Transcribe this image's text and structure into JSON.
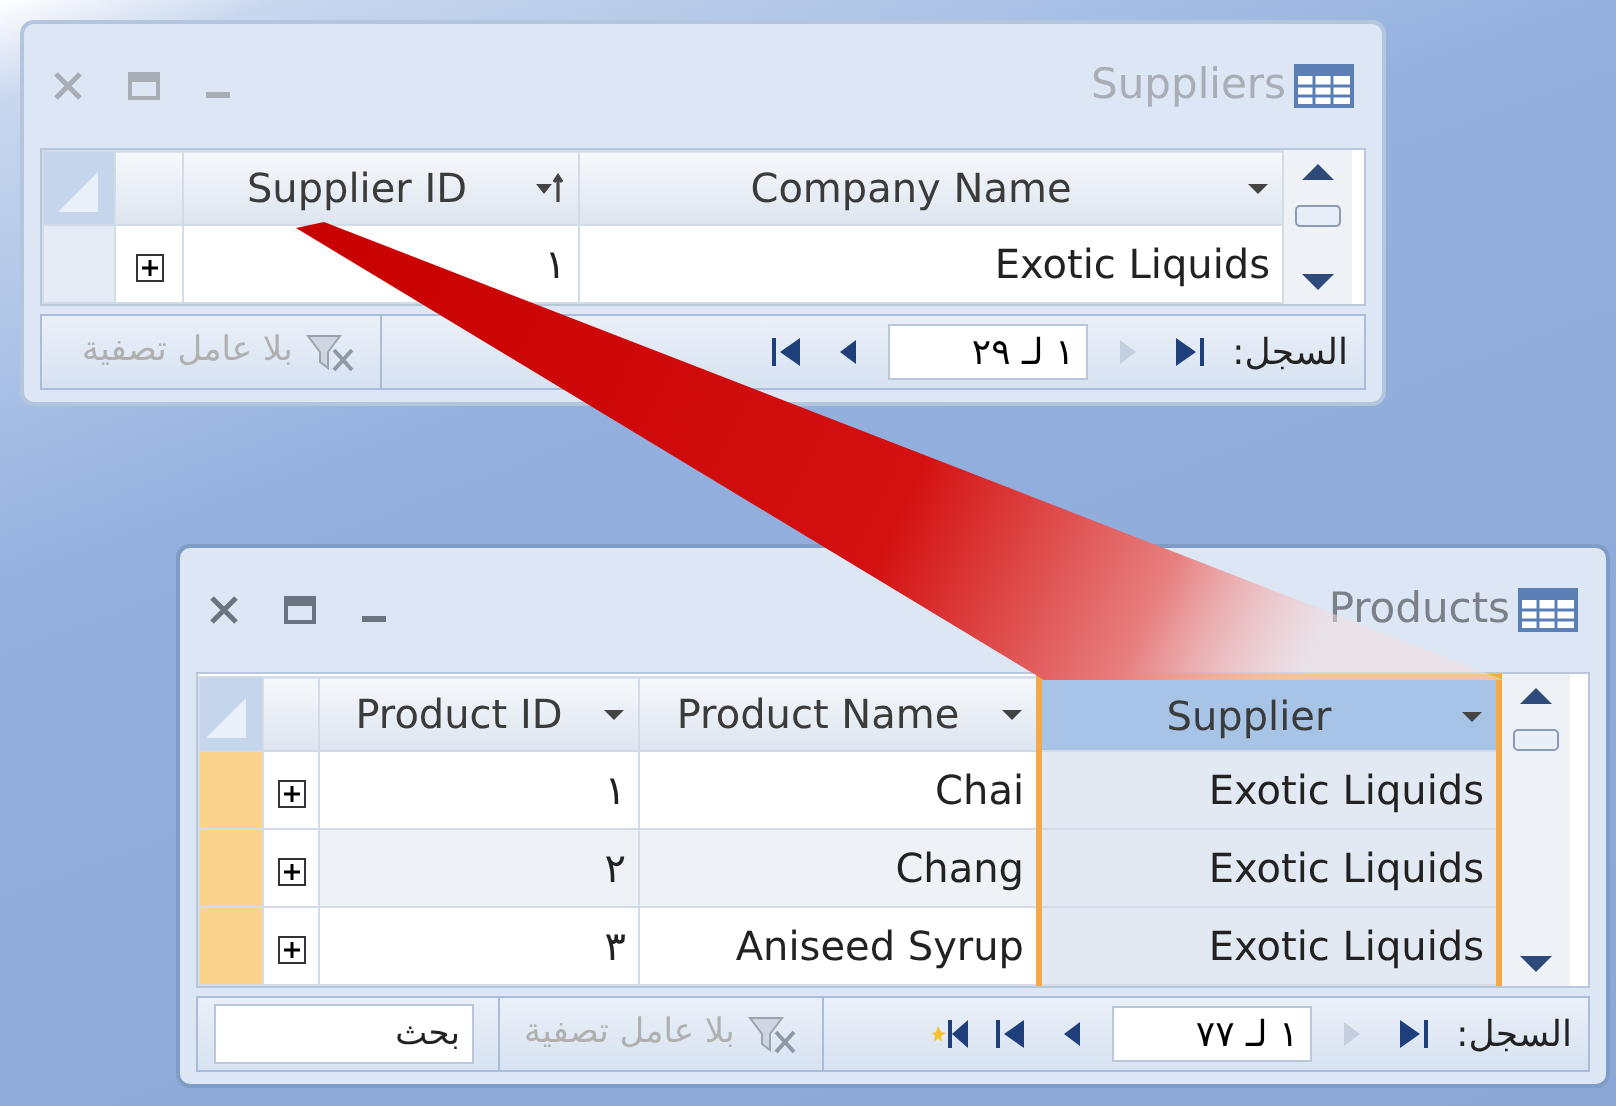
{
  "windows": [
    {
      "title": "Suppliers",
      "active": false,
      "columns": [
        {
          "label": "Company Name",
          "sorted": false,
          "selected": false
        },
        {
          "label": "Supplier ID",
          "sorted": true,
          "selected": false
        }
      ],
      "rows": [
        {
          "selected": false,
          "cells": [
            "Exotic Liquids",
            "١"
          ]
        }
      ],
      "navigation": {
        "label": "السجل:",
        "position": "١ لـ ٢٩",
        "buttons": [
          {
            "kind": "first",
            "disabled": false
          },
          {
            "kind": "previous",
            "disabled": true
          },
          {
            "kind": "next",
            "disabled": false
          },
          {
            "kind": "last",
            "disabled": false
          }
        ],
        "filter": "بلا عامل تصفية"
      }
    },
    {
      "title": "Products",
      "active": true,
      "columns": [
        {
          "label": "Supplier",
          "sorted": false,
          "selected": true
        },
        {
          "label": "Product Name",
          "sorted": false,
          "selected": false
        },
        {
          "label": "Product ID",
          "sorted": false,
          "selected": false
        }
      ],
      "rows": [
        {
          "selected": true,
          "cells": [
            "Exotic Liquids",
            "Chai",
            "١"
          ]
        },
        {
          "selected": true,
          "cells": [
            "Exotic Liquids",
            "Chang",
            "٢"
          ]
        },
        {
          "selected": true,
          "cells": [
            "Exotic Liquids",
            "Aniseed Syrup",
            "٣"
          ]
        }
      ],
      "navigation": {
        "label": "السجل:",
        "position": "١ لـ ٧٧",
        "buttons": [
          {
            "kind": "first",
            "disabled": false
          },
          {
            "kind": "previous",
            "disabled": true
          },
          {
            "kind": "next",
            "disabled": false
          },
          {
            "kind": "last",
            "disabled": false
          },
          {
            "kind": "new",
            "disabled": false
          }
        ],
        "filter": "بلا عامل تصفية",
        "search": {
          "placeholder": "بحث"
        }
      }
    }
  ]
}
